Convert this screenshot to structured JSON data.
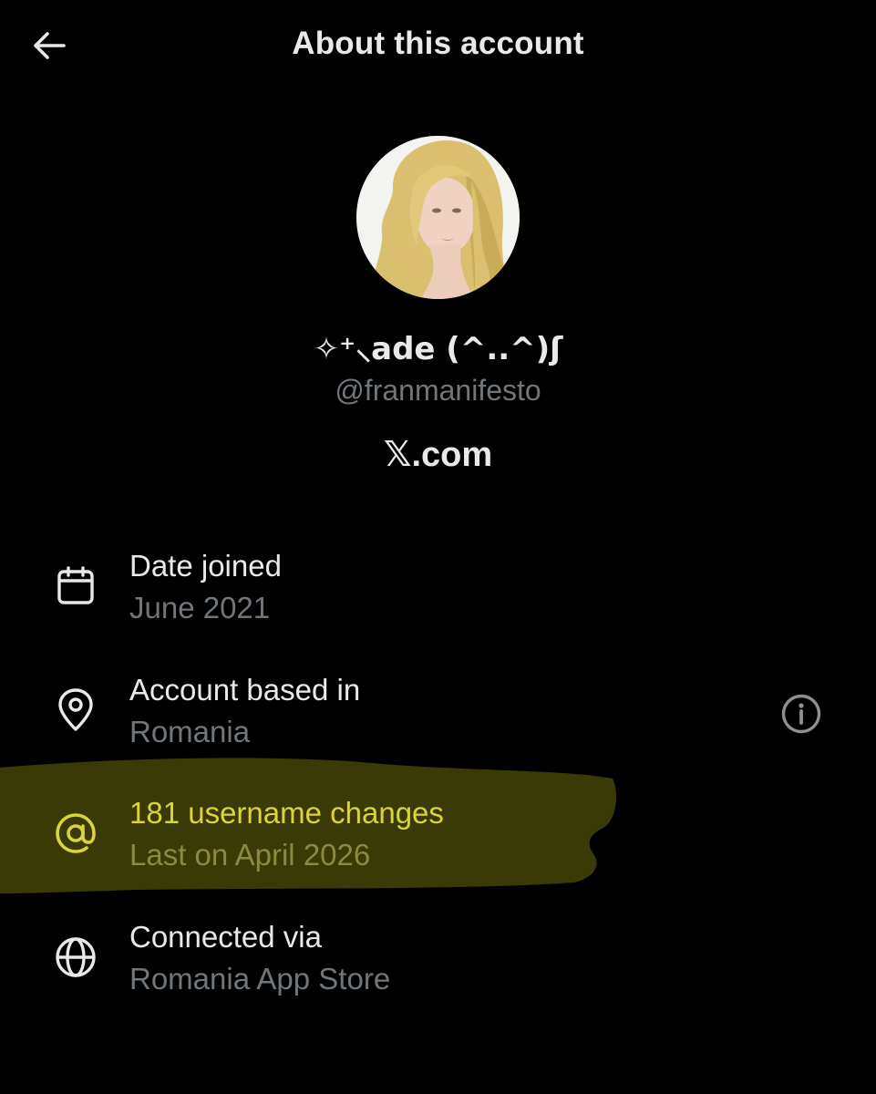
{
  "header": {
    "back_icon": "arrow-left-icon",
    "title": "About this account"
  },
  "profile": {
    "display_name": "✧⁺⸜ade (^..^)ʃ",
    "handle": "@franmanifesto",
    "site": "𝕏.com"
  },
  "details": [
    {
      "icon": "calendar-icon",
      "label": "Date joined",
      "value": "June 2021"
    },
    {
      "icon": "location-pin-icon",
      "label": "Account based in",
      "value": "Romania"
    },
    {
      "icon": "at-sign-icon",
      "label": "181 username changes",
      "value": "Last on April 2026"
    },
    {
      "icon": "globe-icon",
      "label": "Connected via",
      "value": "Romania App Store"
    }
  ],
  "info_icon": "info-icon",
  "colors": {
    "background": "#000000",
    "primary_text": "#e7e9ea",
    "secondary_text": "#71767b",
    "highlight": "#3a3a06",
    "highlight_text": "#d9d43a"
  }
}
